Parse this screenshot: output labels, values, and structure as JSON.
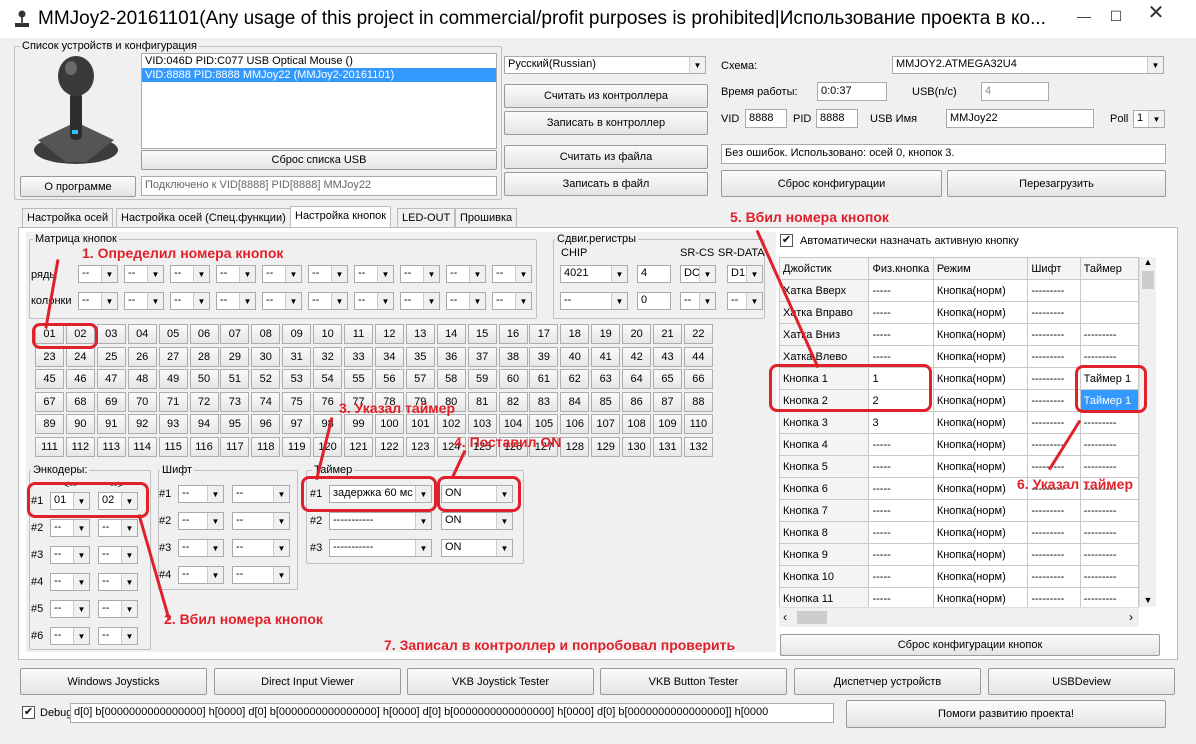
{
  "window": {
    "title": "MMJoy2-20161101(Any usage of this project in commercial/profit purposes is prohibited|Использование проекта в ко..."
  },
  "devices": {
    "group_label": "Список устройств и конфигурация",
    "items": [
      "VID:046D PID:C077 USB Optical Mouse ()",
      "VID:8888 PID:8888 MMJoy22 (MMJoy2-20161101)"
    ],
    "reset_btn": "Сброс списка USB",
    "about_btn": "О программе",
    "status": "Подключено к VID[8888] PID[8888] MMJoy22"
  },
  "mid": {
    "language": "Русский(Russian)",
    "read_ctrl": "Считать из контроллера",
    "write_ctrl": "Записать в контроллер",
    "read_file": "Считать из файла",
    "write_file": "Записать в файл"
  },
  "right": {
    "scheme_label": "Схема:",
    "scheme": "MMJOY2.ATMEGA32U4",
    "uptime_label": "Время работы:",
    "uptime": "0:0:37",
    "usb_label": "USB(n/c)",
    "usb_value": "4",
    "vid_label": "VID",
    "vid": "8888",
    "pid_label": "PID",
    "pid": "8888",
    "usbname_label": "USB Имя",
    "usbname": "MMJoy22",
    "poll_label": "Poll",
    "poll": "1",
    "status": "Без ошибок. Использовано: осей  0, кнопок  3.",
    "reset_cfg": "Сброс конфигурации",
    "reboot": "Перезагрузить"
  },
  "tabs": [
    "Настройка осей",
    "Настройка осей (Спец.функции)",
    "Настройка кнопок",
    "LED-OUT",
    "Прошивка"
  ],
  "matrix": {
    "label": "Матрица кнопок",
    "rows_label": "ряды",
    "cols_label": "колонки",
    "dash": "--"
  },
  "shift_regs": {
    "label": "Сдвиг.регистры",
    "chip_label": "CHIP",
    "srcs_label": "SR-CS",
    "srdata_label": "SR-DATA",
    "chip": "4021",
    "count": "4",
    "srcs": "DC",
    "srdata": "D1",
    "chip2": "--",
    "count2": "0",
    "srcs2": "--",
    "srdata2": "--"
  },
  "buttons": [
    "01",
    "02",
    "03",
    "04",
    "05",
    "06",
    "07",
    "08",
    "09",
    "10",
    "11",
    "12",
    "13",
    "14",
    "15",
    "16",
    "17",
    "18",
    "19",
    "20",
    "21",
    "22",
    "23",
    "24",
    "25",
    "26",
    "27",
    "28",
    "29",
    "30",
    "31",
    "32",
    "33",
    "34",
    "35",
    "36",
    "37",
    "38",
    "39",
    "40",
    "41",
    "42",
    "43",
    "44",
    "45",
    "46",
    "47",
    "48",
    "49",
    "50",
    "51",
    "52",
    "53",
    "54",
    "55",
    "56",
    "57",
    "58",
    "59",
    "60",
    "61",
    "62",
    "63",
    "64",
    "65",
    "66",
    "67",
    "68",
    "69",
    "70",
    "71",
    "72",
    "73",
    "74",
    "75",
    "76",
    "77",
    "78",
    "79",
    "80",
    "81",
    "82",
    "83",
    "84",
    "85",
    "86",
    "87",
    "88",
    "89",
    "90",
    "91",
    "92",
    "93",
    "94",
    "95",
    "96",
    "97",
    "98",
    "99",
    "100",
    "101",
    "102",
    "103",
    "104",
    "105",
    "106",
    "107",
    "108",
    "109",
    "110",
    "111",
    "112",
    "113",
    "114",
    "115",
    "116",
    "117",
    "118",
    "119",
    "120",
    "121",
    "122",
    "123",
    "124",
    "125",
    "126",
    "127",
    "128",
    "129",
    "130",
    "131",
    "132"
  ],
  "encoders": {
    "label": "Энкодеры:",
    "left_arrow": "<--",
    "right_arrow": "-->",
    "rows": [
      {
        "n": "#1",
        "a": "01",
        "b": "02"
      },
      {
        "n": "#2",
        "a": "--",
        "b": "--"
      },
      {
        "n": "#3",
        "a": "--",
        "b": "--"
      },
      {
        "n": "#4",
        "a": "--",
        "b": "--"
      },
      {
        "n": "#5",
        "a": "--",
        "b": "--"
      },
      {
        "n": "#6",
        "a": "--",
        "b": "--"
      }
    ]
  },
  "shift": {
    "label": "Шифт",
    "rows": [
      {
        "n": "#1",
        "a": "--",
        "b": "--"
      },
      {
        "n": "#2",
        "a": "--",
        "b": "--"
      },
      {
        "n": "#3",
        "a": "--",
        "b": "--"
      },
      {
        "n": "#4",
        "a": "--",
        "b": "--"
      }
    ]
  },
  "timer": {
    "label": "Таймер",
    "rows": [
      {
        "n": "#1",
        "a": "задержка 60 мс",
        "b": "ON"
      },
      {
        "n": "#2",
        "a": "-----------",
        "b": "ON"
      },
      {
        "n": "#3",
        "a": "-----------",
        "b": "ON"
      }
    ]
  },
  "auto_assign": "Автоматически назначать активную кнопку",
  "table": {
    "headers": [
      "Джойстик",
      "Физ.кнопка",
      "Режим",
      "Шифт",
      "Таймер"
    ],
    "rows": [
      [
        "Хатка Вверх",
        "-----",
        "Кнопка(норм)",
        "---------",
        ""
      ],
      [
        "Хатка Вправо",
        "-----",
        "Кнопка(норм)",
        "---------",
        ""
      ],
      [
        "Хатка Вниз",
        "-----",
        "Кнопка(норм)",
        "---------",
        "---------"
      ],
      [
        "Хатка Влево",
        "-----",
        "Кнопка(норм)",
        "---------",
        "---------"
      ],
      [
        "Кнопка 1",
        "1",
        "Кнопка(норм)",
        "---------",
        "Таймер 1"
      ],
      [
        "Кнопка 2",
        "2",
        "Кнопка(норм)",
        "---------",
        "Таймер 1"
      ],
      [
        "Кнопка 3",
        "3",
        "Кнопка(норм)",
        "---------",
        "---------"
      ],
      [
        "Кнопка 4",
        "-----",
        "Кнопка(норм)",
        "---------",
        "---------"
      ],
      [
        "Кнопка 5",
        "-----",
        "Кнопка(норм)",
        "---------",
        "---------"
      ],
      [
        "Кнопка 6",
        "-----",
        "Кнопка(норм)",
        "---------",
        "---------"
      ],
      [
        "Кнопка 7",
        "-----",
        "Кнопка(норм)",
        "---------",
        "---------"
      ],
      [
        "Кнопка 8",
        "-----",
        "Кнопка(норм)",
        "---------",
        "---------"
      ],
      [
        "Кнопка 9",
        "-----",
        "Кнопка(норм)",
        "---------",
        "---------"
      ],
      [
        "Кнопка 10",
        "-----",
        "Кнопка(норм)",
        "---------",
        "---------"
      ],
      [
        "Кнопка 11",
        "-----",
        "Кнопка(норм)",
        "---------",
        "---------"
      ]
    ],
    "reset_btn": "Сброс конфигурации кнопок"
  },
  "bottom": [
    "Windows Joysticks",
    "Direct Input Viewer",
    "VKB Joystick Tester",
    "VKB Button Tester",
    "Диспетчер устройств",
    "USBDeview"
  ],
  "debug": {
    "label": "Debug",
    "text": "d[0] b[0000000000000000] h[0000]   d[0] b[0000000000000000] h[0000]   d[0] b[0000000000000000] h[0000]   d[0] b[0000000000000000]] h[0000",
    "help": "Помоги развитию проекта!"
  },
  "annotations": [
    "1. Определил номера кнопок",
    "2. Вбил номера кнопок",
    "3. Указал таймер",
    "4. Поставил ON",
    "5. Вбил номера кнопок",
    "6. Указал таймер",
    "7. Записал в контроллер и попробовал проверить"
  ],
  "colors": {
    "selection": "#3399ff",
    "annotation": "#e0202a"
  }
}
